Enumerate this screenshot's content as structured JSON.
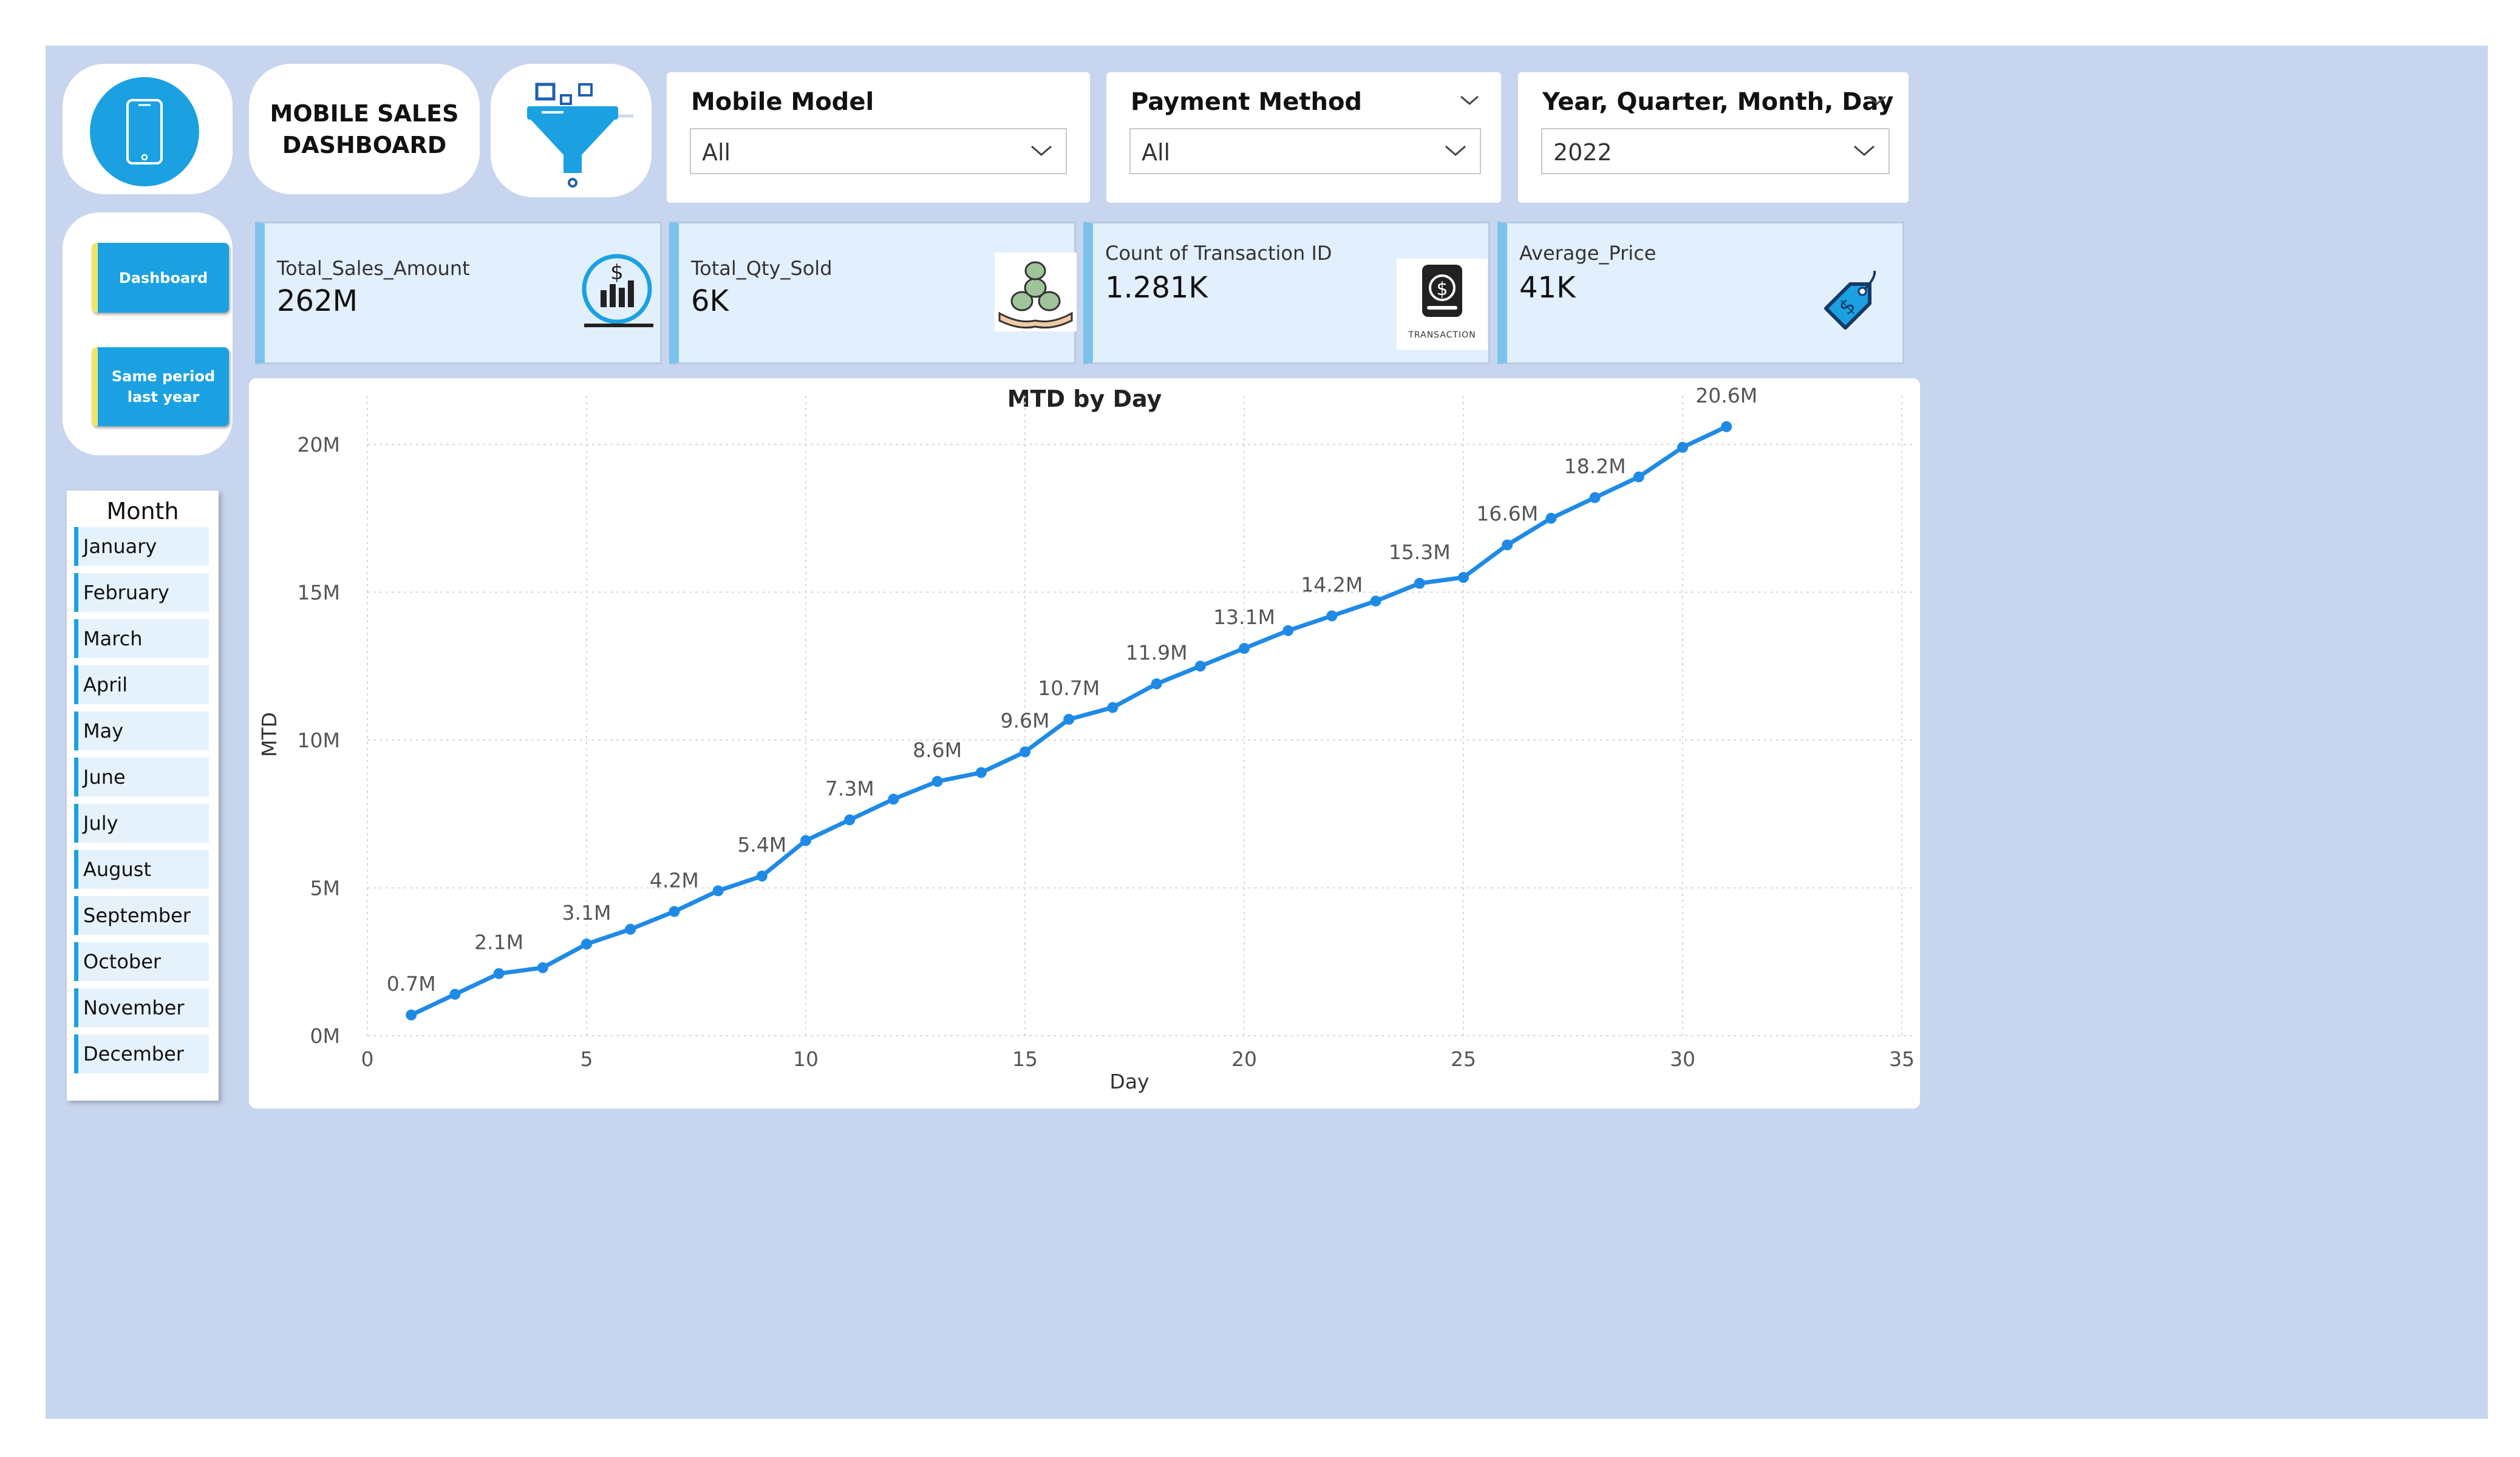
{
  "header": {
    "dashboard_title": "MOBILE SALES\nDASHBOARD"
  },
  "icons": {
    "phone": "smartphone-icon",
    "filter": "funnel-filter-icon",
    "sales": "dollar-bar-chart-icon",
    "qty": "money-stack-hand-icon",
    "transaction": "transaction-wallet-icon",
    "price": "price-tag-icon"
  },
  "slicers": {
    "mobile_model": {
      "title": "Mobile Model",
      "value": "All"
    },
    "payment_method": {
      "title": "Payment Method",
      "value": "All"
    },
    "date_hierarchy": {
      "title": "Year, Quarter, Month, Day",
      "value": "2022"
    }
  },
  "nav": {
    "dashboard": "Dashboard",
    "same_period": "Same period last year"
  },
  "month_slicer": {
    "title": "Month",
    "items": [
      "January",
      "February",
      "March",
      "April",
      "May",
      "June",
      "July",
      "August",
      "September",
      "October",
      "November",
      "December"
    ]
  },
  "kpis": [
    {
      "label": "Total_Sales_Amount",
      "value": "262M"
    },
    {
      "label": "Total_Qty_Sold",
      "value": "6K"
    },
    {
      "label": "Count of Transaction ID",
      "value": "1.281K",
      "icon_caption": "TRANSACTION"
    },
    {
      "label": "Average_Price",
      "value": "41K"
    }
  ],
  "colors": {
    "accent": "#1ba1e2",
    "line": "#1f8ae6",
    "background": "#c8d5ee",
    "kpi_bg": "#e2effc"
  },
  "chart_data": {
    "type": "line",
    "title": "MTD by Day",
    "xlabel": "Day",
    "ylabel": "MTD",
    "xlim": [
      0,
      35
    ],
    "ylim": [
      0,
      22
    ],
    "x_ticks": [
      0,
      5,
      10,
      15,
      20,
      25,
      30,
      35
    ],
    "y_ticks": [
      0,
      5,
      10,
      15,
      20
    ],
    "y_tick_labels": [
      "0M",
      "5M",
      "10M",
      "15M",
      "20M"
    ],
    "grid": true,
    "series": [
      {
        "x": [
          1,
          2,
          3,
          4,
          5,
          6,
          7,
          8,
          9,
          10,
          11,
          12,
          13,
          14,
          15,
          16,
          17,
          18,
          19,
          20,
          21,
          22,
          23,
          24,
          25,
          26,
          27,
          28,
          29,
          30,
          31
        ],
        "values": [
          0.7,
          1.4,
          2.1,
          2.3,
          3.1,
          3.6,
          4.2,
          4.9,
          5.4,
          6.6,
          7.3,
          8.0,
          8.6,
          8.9,
          9.6,
          10.7,
          11.1,
          11.9,
          12.5,
          13.1,
          13.7,
          14.2,
          14.7,
          15.3,
          15.5,
          16.6,
          17.5,
          18.2,
          18.9,
          19.9,
          20.6
        ]
      }
    ],
    "data_labels": [
      {
        "x": 1,
        "text": "0.7M"
      },
      {
        "x": 3,
        "text": "2.1M"
      },
      {
        "x": 5,
        "text": "3.1M"
      },
      {
        "x": 7,
        "text": "4.2M"
      },
      {
        "x": 9,
        "text": "5.4M"
      },
      {
        "x": 11,
        "text": "7.3M"
      },
      {
        "x": 13,
        "text": "8.6M"
      },
      {
        "x": 15,
        "text": "9.6M"
      },
      {
        "x": 16,
        "text": "10.7M"
      },
      {
        "x": 18,
        "text": "11.9M"
      },
      {
        "x": 20,
        "text": "13.1M"
      },
      {
        "x": 22,
        "text": "14.2M"
      },
      {
        "x": 24,
        "text": "15.3M"
      },
      {
        "x": 26,
        "text": "16.6M"
      },
      {
        "x": 28,
        "text": "18.2M"
      },
      {
        "x": 31,
        "text": "20.6M"
      }
    ]
  }
}
